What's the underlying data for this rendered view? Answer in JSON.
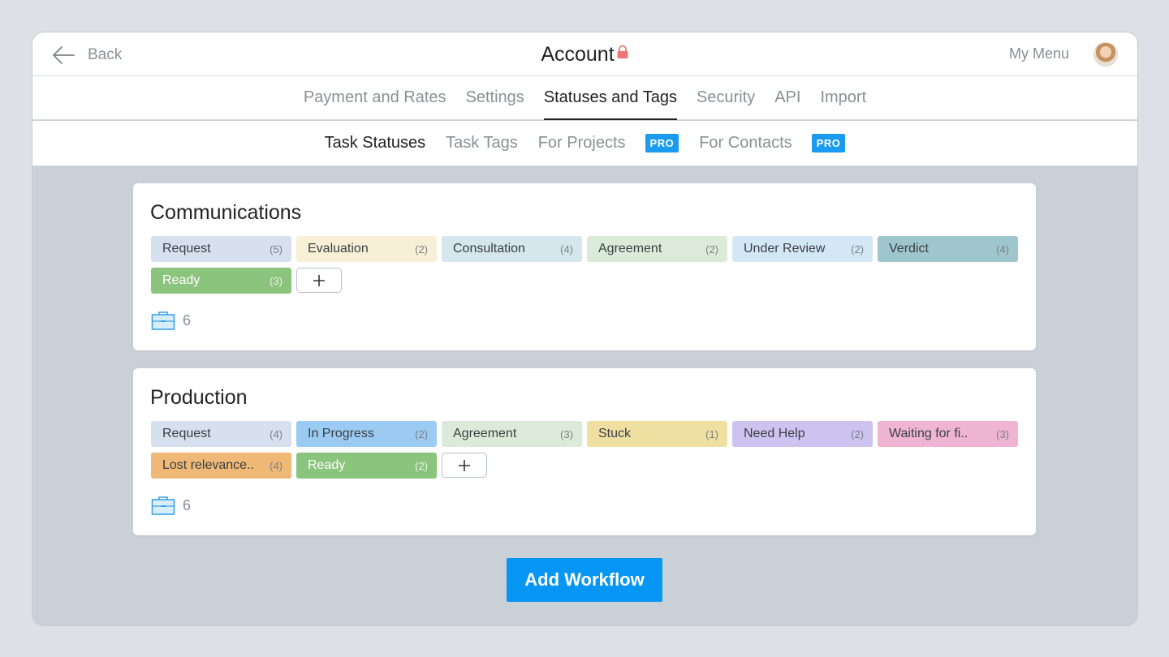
{
  "header": {
    "back_label": "Back",
    "title": "Account",
    "my_menu_label": "My Menu"
  },
  "main_tabs": [
    {
      "label": "Payment and Rates",
      "active": false
    },
    {
      "label": "Settings",
      "active": false
    },
    {
      "label": "Statuses and Tags",
      "active": true
    },
    {
      "label": "Security",
      "active": false
    },
    {
      "label": "API",
      "active": false
    },
    {
      "label": "Import",
      "active": false
    }
  ],
  "sub_tabs": [
    {
      "label": "Task Statuses",
      "active": true,
      "badge": ""
    },
    {
      "label": "Task Tags",
      "active": false,
      "badge": ""
    },
    {
      "label": "For Projects",
      "active": false,
      "badge": "PRO"
    },
    {
      "label": "For Contacts",
      "active": false,
      "badge": "PRO"
    }
  ],
  "workflows": [
    {
      "name": "Communications",
      "project_count": "6",
      "statuses": [
        {
          "label": "Request",
          "count": "(5)",
          "color": "#d7e0ee"
        },
        {
          "label": "Evaluation",
          "count": "(2)",
          "color": "#f7efd6"
        },
        {
          "label": "Consultation",
          "count": "(4)",
          "color": "#d5e6ed"
        },
        {
          "label": "Agreement",
          "count": "(2)",
          "color": "#dcebd9"
        },
        {
          "label": "Under Review",
          "count": "(2)",
          "color": "#d4e7f5"
        },
        {
          "label": "Verdict",
          "count": "(4)",
          "color": "#9fc6cc"
        },
        {
          "label": "Ready",
          "count": "(3)",
          "color": "#8bc47c",
          "text_color": "#ffffff"
        }
      ]
    },
    {
      "name": "Production",
      "project_count": "6",
      "statuses": [
        {
          "label": "Request",
          "count": "(4)",
          "color": "#d7e0ee"
        },
        {
          "label": "In Progress",
          "count": "(2)",
          "color": "#9bcbf2"
        },
        {
          "label": "Agreement",
          "count": "(3)",
          "color": "#dcebd9"
        },
        {
          "label": "Stuck",
          "count": "(1)",
          "color": "#efe0a2"
        },
        {
          "label": "Need Help",
          "count": "(2)",
          "color": "#cdc3f0"
        },
        {
          "label": "Waiting for fi..",
          "count": "(3)",
          "color": "#f0b4d3"
        },
        {
          "label": "Lost relevance..",
          "count": "(4)",
          "color": "#efb876"
        },
        {
          "label": "Ready",
          "count": "(2)",
          "color": "#8bc47c",
          "text_color": "#ffffff"
        }
      ]
    }
  ],
  "add_workflow_label": "Add Workflow",
  "colors": {
    "accent": "#0796f4",
    "lock": "#f27474"
  },
  "icons": [
    "back-arrow-icon",
    "lock-icon",
    "plus-icon",
    "briefcase-icon"
  ]
}
